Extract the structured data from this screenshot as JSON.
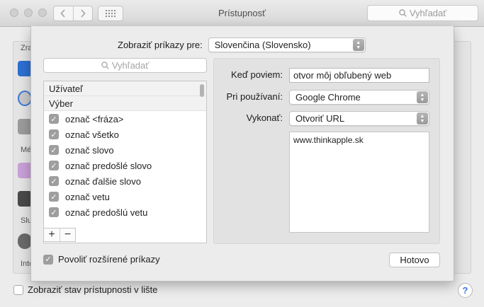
{
  "window": {
    "title": "Prístupnosť",
    "search_placeholder": "Vyhľadať",
    "nav_back": "‹",
    "nav_forward": "›"
  },
  "background": {
    "sidebar_fragments": [
      "Zra",
      "Mé",
      "Slu",
      "Inte"
    ],
    "show_status_label": "Zobraziť stav prístupnosti v lište",
    "show_status_checked": false,
    "help_label": "?"
  },
  "sheet": {
    "language_label": "Zobraziť príkazy pre:",
    "language_value": "Slovenčina (Slovensko)",
    "list_search_placeholder": "Vyhľadať",
    "groups": [
      {
        "label": "Užívateľ",
        "items": []
      },
      {
        "label": "Výber",
        "items": [
          {
            "label": "označ <fráza>",
            "checked": true
          },
          {
            "label": "označ všetko",
            "checked": true
          },
          {
            "label": "označ slovo",
            "checked": true
          },
          {
            "label": "označ predošlé slovo",
            "checked": true
          },
          {
            "label": "označ ďalšie slovo",
            "checked": true
          },
          {
            "label": "označ vetu",
            "checked": true
          },
          {
            "label": "označ predošlú vetu",
            "checked": true
          }
        ]
      }
    ],
    "add_label": "+",
    "remove_label": "−",
    "detail": {
      "when_label": "Keď poviem:",
      "when_value": "otvor môj obľubený web",
      "while_label": "Pri používaní:",
      "while_value": "Google Chrome",
      "perform_label": "Vykonať:",
      "perform_value": "Otvoriť URL",
      "url_value": "www.thinkapple.sk"
    },
    "advanced_label": "Povoliť rozšírené príkazy",
    "advanced_checked": true,
    "done_label": "Hotovo"
  },
  "colors": {
    "accent_help": "#3a76e6",
    "checkbox_checked": "#9e9e9e"
  }
}
